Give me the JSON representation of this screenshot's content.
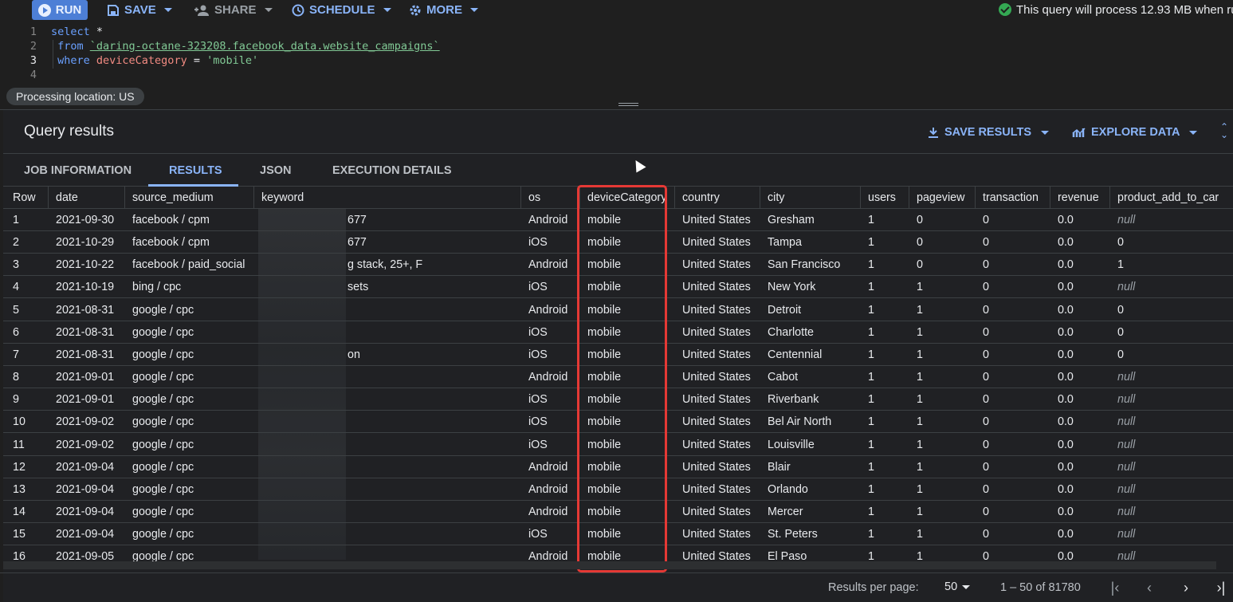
{
  "toolbar": {
    "run_label": "RUN",
    "save_label": "SAVE",
    "share_label": "SHARE",
    "schedule_label": "SCHEDULE",
    "more_label": "MORE",
    "status_text": "This query will process 12.93 MB when ru"
  },
  "editor": {
    "lines": [
      {
        "num": "1",
        "tokens": [
          [
            "kw",
            "select"
          ],
          [
            "plain",
            " *"
          ]
        ]
      },
      {
        "num": "2",
        "tokens": [
          [
            "kw",
            " from "
          ],
          [
            "str-tbl",
            "`daring-octane-323208.facebook_data.website_campaigns`"
          ]
        ]
      },
      {
        "num": "3",
        "tokens": [
          [
            "kw",
            " where "
          ],
          [
            "ident",
            "deviceCategory"
          ],
          [
            "plain",
            " = "
          ],
          [
            "strv",
            "'mobile'"
          ]
        ]
      },
      {
        "num": "4",
        "tokens": []
      }
    ],
    "processing_location": "Processing location: US"
  },
  "results": {
    "title": "Query results",
    "save_results_label": "SAVE RESULTS",
    "explore_data_label": "EXPLORE DATA",
    "tabs": [
      "JOB INFORMATION",
      "RESULTS",
      "JSON",
      "EXECUTION DETAILS"
    ],
    "active_tab": "RESULTS",
    "columns": [
      "Row",
      "date",
      "source_medium",
      "keyword",
      "os",
      "deviceCategory",
      "country",
      "city",
      "users",
      "pageview",
      "transaction",
      "revenue",
      "product_add_to_car"
    ],
    "rows": [
      [
        "1",
        "2021-09-30",
        "facebook / cpm",
        "677",
        "Android",
        "mobile",
        "United States",
        "Gresham",
        "1",
        "0",
        "0",
        "0.0",
        "null"
      ],
      [
        "2",
        "2021-10-29",
        "facebook / cpm",
        "677",
        "iOS",
        "mobile",
        "United States",
        "Tampa",
        "1",
        "0",
        "0",
        "0.0",
        "0"
      ],
      [
        "3",
        "2021-10-22",
        "facebook / paid_social",
        "g stack, 25+, F",
        "Android",
        "mobile",
        "United States",
        "San Francisco",
        "1",
        "0",
        "0",
        "0.0",
        "1"
      ],
      [
        "4",
        "2021-10-19",
        "bing / cpc",
        "sets",
        "iOS",
        "mobile",
        "United States",
        "New York",
        "1",
        "1",
        "0",
        "0.0",
        "null"
      ],
      [
        "5",
        "2021-08-31",
        "google / cpc",
        "",
        "Android",
        "mobile",
        "United States",
        "Detroit",
        "1",
        "1",
        "0",
        "0.0",
        "0"
      ],
      [
        "6",
        "2021-08-31",
        "google / cpc",
        "",
        "iOS",
        "mobile",
        "United States",
        "Charlotte",
        "1",
        "1",
        "0",
        "0.0",
        "0"
      ],
      [
        "7",
        "2021-08-31",
        "google / cpc",
        "on",
        "iOS",
        "mobile",
        "United States",
        "Centennial",
        "1",
        "1",
        "0",
        "0.0",
        "0"
      ],
      [
        "8",
        "2021-09-01",
        "google / cpc",
        "",
        "Android",
        "mobile",
        "United States",
        "Cabot",
        "1",
        "1",
        "0",
        "0.0",
        "null"
      ],
      [
        "9",
        "2021-09-01",
        "google / cpc",
        "",
        "iOS",
        "mobile",
        "United States",
        "Riverbank",
        "1",
        "1",
        "0",
        "0.0",
        "null"
      ],
      [
        "10",
        "2021-09-02",
        "google / cpc",
        "",
        "iOS",
        "mobile",
        "United States",
        "Bel Air North",
        "1",
        "1",
        "0",
        "0.0",
        "null"
      ],
      [
        "11",
        "2021-09-02",
        "google / cpc",
        "",
        "iOS",
        "mobile",
        "United States",
        "Louisville",
        "1",
        "1",
        "0",
        "0.0",
        "null"
      ],
      [
        "12",
        "2021-09-04",
        "google / cpc",
        "",
        "Android",
        "mobile",
        "United States",
        "Blair",
        "1",
        "1",
        "0",
        "0.0",
        "null"
      ],
      [
        "13",
        "2021-09-04",
        "google / cpc",
        "",
        "Android",
        "mobile",
        "United States",
        "Orlando",
        "1",
        "1",
        "0",
        "0.0",
        "null"
      ],
      [
        "14",
        "2021-09-04",
        "google / cpc",
        "",
        "Android",
        "mobile",
        "United States",
        "Mercer",
        "1",
        "1",
        "0",
        "0.0",
        "null"
      ],
      [
        "15",
        "2021-09-04",
        "google / cpc",
        "",
        "iOS",
        "mobile",
        "United States",
        "St. Peters",
        "1",
        "1",
        "0",
        "0.0",
        "null"
      ],
      [
        "16",
        "2021-09-05",
        "google / cpc",
        "",
        "Android",
        "mobile",
        "United States",
        "El Paso",
        "1",
        "1",
        "0",
        "0.0",
        "null"
      ]
    ]
  },
  "footer": {
    "results_per_page_label": "Results per page:",
    "per_page_value": "50",
    "range_text": "1 – 50 of 81780"
  },
  "colors": {
    "accent": "#8ab4f8",
    "run_button": "#4d7fd6",
    "success": "#34a853",
    "highlight": "#e53935"
  },
  "icons": [
    "play-icon",
    "save-icon",
    "share-person-icon",
    "schedule-clock-icon",
    "gear-icon",
    "check-circle-icon",
    "download-icon",
    "chart-icon",
    "expand-icon",
    "first-page-icon",
    "prev-page-icon",
    "next-page-icon",
    "last-page-icon"
  ]
}
